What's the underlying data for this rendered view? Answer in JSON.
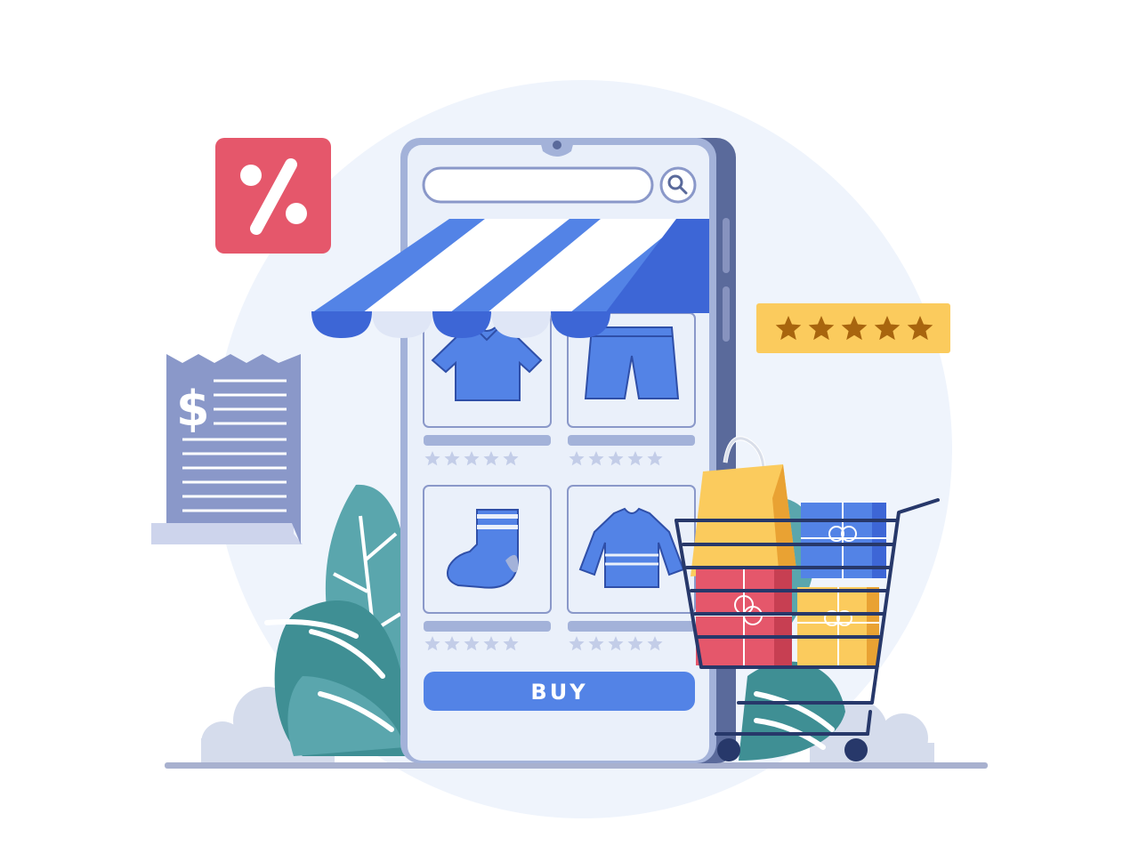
{
  "buy_button": {
    "label": "BUY"
  },
  "receipt": {
    "currency_symbol": "$"
  },
  "discount_badge": {
    "icon": "percent-icon"
  },
  "rating_badge": {
    "rating": 5,
    "max": 5
  },
  "products": [
    {
      "icon": "tshirt-icon",
      "rating": 0,
      "max": 5
    },
    {
      "icon": "shorts-icon",
      "rating": 0,
      "max": 5
    },
    {
      "icon": "sock-icon",
      "rating": 0,
      "max": 5
    },
    {
      "icon": "sweater-icon",
      "rating": 0,
      "max": 5
    }
  ],
  "colors": {
    "primary_blue": "#5383e6",
    "badge_red": "#e5576b",
    "badge_yellow": "#fbcb5d",
    "star_brown": "#a8650e",
    "leaf_teal": "#5aa6ad"
  }
}
